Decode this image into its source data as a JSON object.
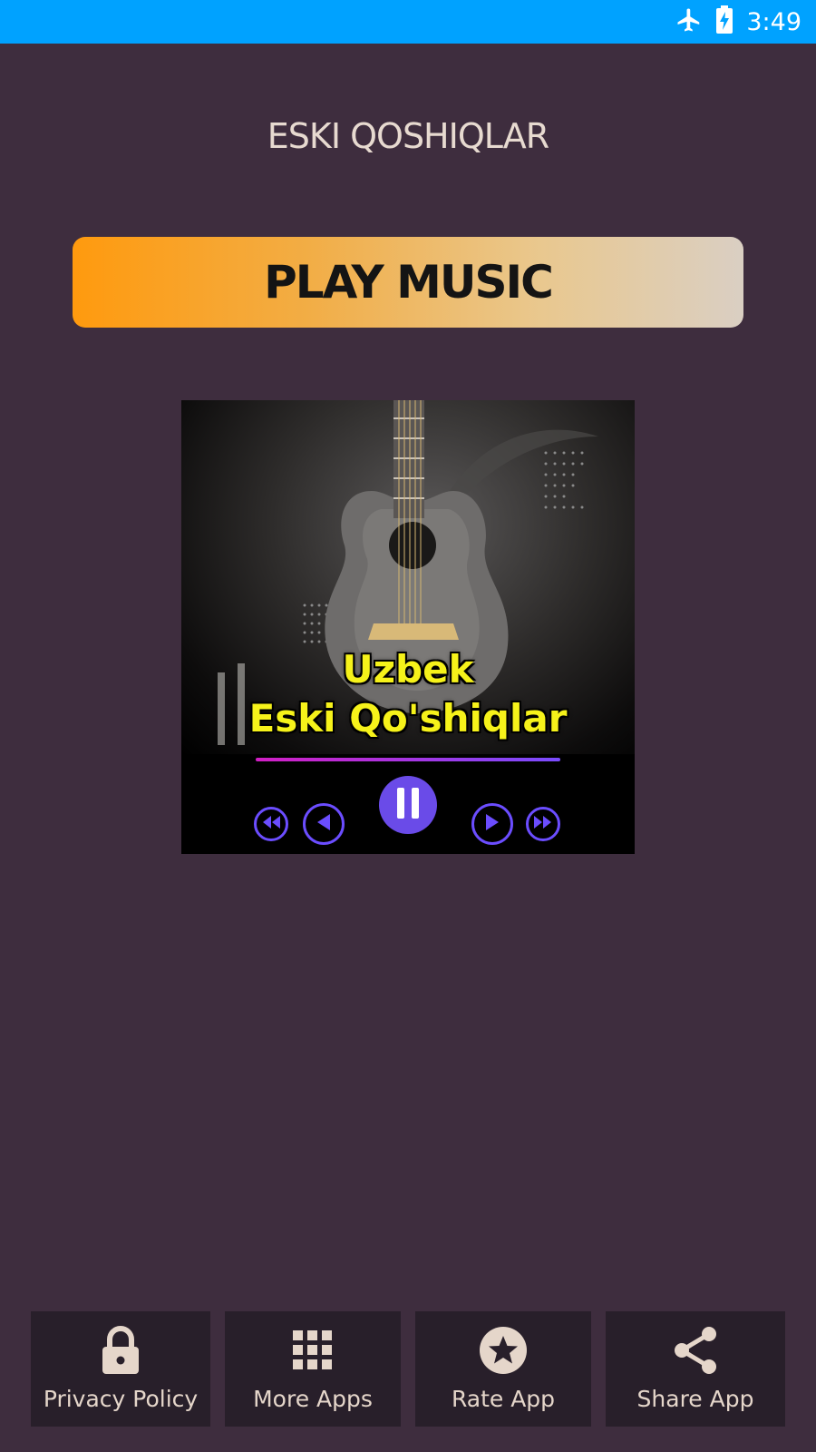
{
  "status_bar": {
    "time": "3:49",
    "icons": [
      "airplane-mode-icon",
      "battery-charging-icon"
    ],
    "background": "#00a2ff"
  },
  "header": {
    "title": "ESKI QOSHIQLAR"
  },
  "play_button": {
    "label": "PLAY MUSIC"
  },
  "player": {
    "cover_line1": "Uzbek",
    "cover_line2": "Eski Qo'shiqlar",
    "controls": [
      "rewind-icon",
      "previous-icon",
      "pause-icon",
      "next-icon",
      "fast-forward-icon"
    ],
    "accent": "#6a4be8"
  },
  "bottom_nav": {
    "items": [
      {
        "label": "Privacy Policy",
        "icon": "lock-icon"
      },
      {
        "label": "More Apps",
        "icon": "grid-icon"
      },
      {
        "label": "Rate App",
        "icon": "star-icon"
      },
      {
        "label": "Share App",
        "icon": "share-icon"
      }
    ]
  },
  "colors": {
    "background": "#3e2d3e",
    "nav_button": "#281f2a",
    "text_light": "#e5d6ca",
    "cover_text": "#f6f21a"
  }
}
